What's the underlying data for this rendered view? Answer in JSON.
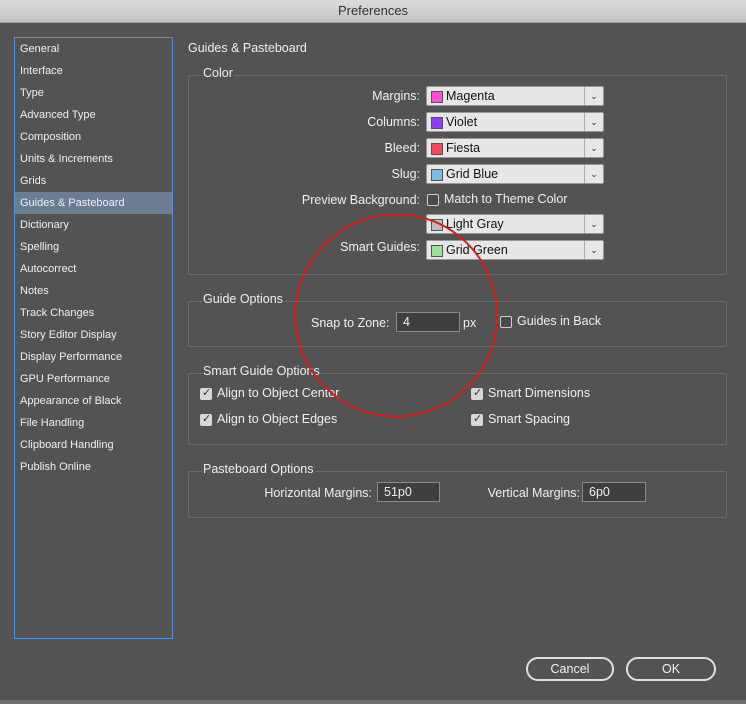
{
  "window": {
    "title": "Preferences"
  },
  "sidebar": {
    "items": [
      {
        "label": "General"
      },
      {
        "label": "Interface"
      },
      {
        "label": "Type"
      },
      {
        "label": "Advanced Type"
      },
      {
        "label": "Composition"
      },
      {
        "label": "Units & Increments"
      },
      {
        "label": "Grids"
      },
      {
        "label": "Guides & Pasteboard"
      },
      {
        "label": "Dictionary"
      },
      {
        "label": "Spelling"
      },
      {
        "label": "Autocorrect"
      },
      {
        "label": "Notes"
      },
      {
        "label": "Track Changes"
      },
      {
        "label": "Story Editor Display"
      },
      {
        "label": "Display Performance"
      },
      {
        "label": "GPU Performance"
      },
      {
        "label": "Appearance of Black"
      },
      {
        "label": "File Handling"
      },
      {
        "label": "Clipboard Handling"
      },
      {
        "label": "Publish Online"
      }
    ],
    "selected_index": 7
  },
  "panel": {
    "title": "Guides & Pasteboard",
    "color": {
      "label": "Color",
      "margins": {
        "label": "Margins:",
        "value": "Magenta",
        "swatch": "#ff4dd8"
      },
      "columns": {
        "label": "Columns:",
        "value": "Violet",
        "swatch": "#8b3dff"
      },
      "bleed": {
        "label": "Bleed:",
        "value": "Fiesta",
        "swatch": "#f2485a"
      },
      "slug": {
        "label": "Slug:",
        "value": "Grid Blue",
        "swatch": "#7bbbe5"
      },
      "preview_background": {
        "label": "Preview Background:",
        "checkbox_label": "Match to Theme Color",
        "checked": false,
        "value": "Light Gray",
        "swatch": "#bcbcbc"
      },
      "smart_guides": {
        "label": "Smart Guides:",
        "value": "Grid Green",
        "swatch": "#9ee09a"
      }
    },
    "guide_options": {
      "label": "Guide Options",
      "snap_label": "Snap to Zone:",
      "snap_value": "4",
      "snap_unit": "px",
      "guides_in_back": {
        "label": "Guides in Back",
        "checked": false
      }
    },
    "smart_guide_options": {
      "label": "Smart Guide Options",
      "align_center": {
        "label": "Align to Object Center",
        "checked": true
      },
      "align_edges": {
        "label": "Align to Object Edges",
        "checked": true
      },
      "smart_dimensions": {
        "label": "Smart Dimensions",
        "checked": true
      },
      "smart_spacing": {
        "label": "Smart Spacing",
        "checked": true
      }
    },
    "pasteboard_options": {
      "label": "Pasteboard Options",
      "horizontal_label": "Horizontal Margins:",
      "horizontal_value": "51p0",
      "vertical_label": "Vertical Margins:",
      "vertical_value": "6p0"
    }
  },
  "buttons": {
    "cancel": "Cancel",
    "ok": "OK"
  },
  "colors": {
    "background": "#535353",
    "selection": "#6a7d93",
    "sidebar_border": "#5a8fd8",
    "annotation_circle": "#d41f1f"
  }
}
